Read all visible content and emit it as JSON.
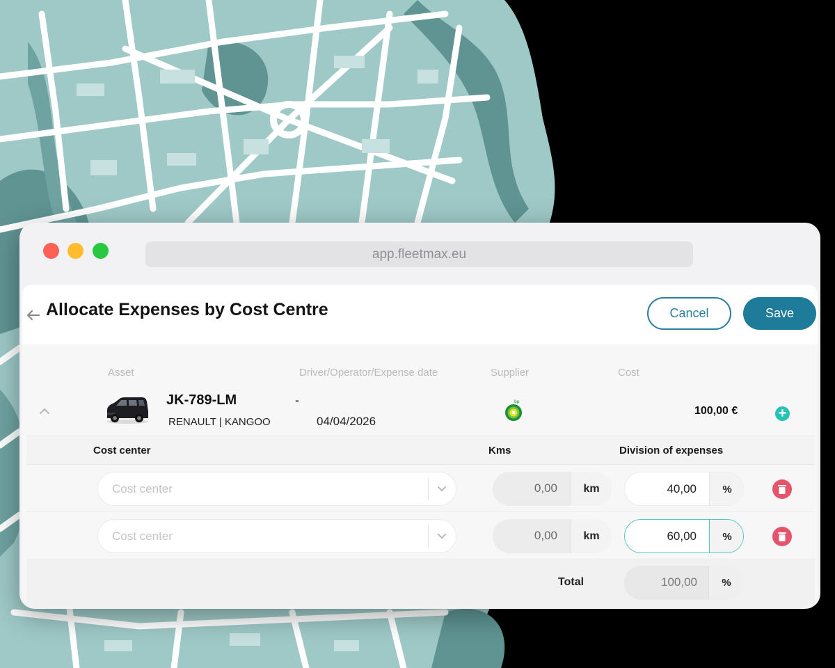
{
  "browser": {
    "url": "app.fleetmax.eu"
  },
  "page": {
    "title": "Allocate Expenses by Cost Centre",
    "cancel_label": "Cancel",
    "save_label": "Save"
  },
  "table": {
    "columns": [
      "Asset",
      "Driver/Operator/Expense date",
      "Supplier",
      "Cost"
    ]
  },
  "expense": {
    "plate": "JK-789-LM",
    "model": "RENAULT | KANGOO",
    "driver": "-",
    "date": "04/04/2026",
    "supplier_icon": "bp-logo",
    "cost": "100,00 €"
  },
  "allocation": {
    "headers": {
      "cost_center": "Cost center",
      "kms": "Kms",
      "division": "Division of expenses"
    },
    "rows": [
      {
        "cost_center_placeholder": "Cost center",
        "kms": "0,00",
        "km_unit": "km",
        "division": "40,00",
        "division_unit": "%"
      },
      {
        "cost_center_placeholder": "Cost center",
        "kms": "0,00",
        "km_unit": "km",
        "division": "60,00",
        "division_unit": "%"
      }
    ],
    "total_label": "Total",
    "total_value": "100,00",
    "total_unit": "%"
  },
  "colors": {
    "accent": "#1e7b9a",
    "teal": "#27c2b6",
    "delete": "#e5546a",
    "map_water": "#5f9493",
    "map_land": "#9ec9c7"
  }
}
